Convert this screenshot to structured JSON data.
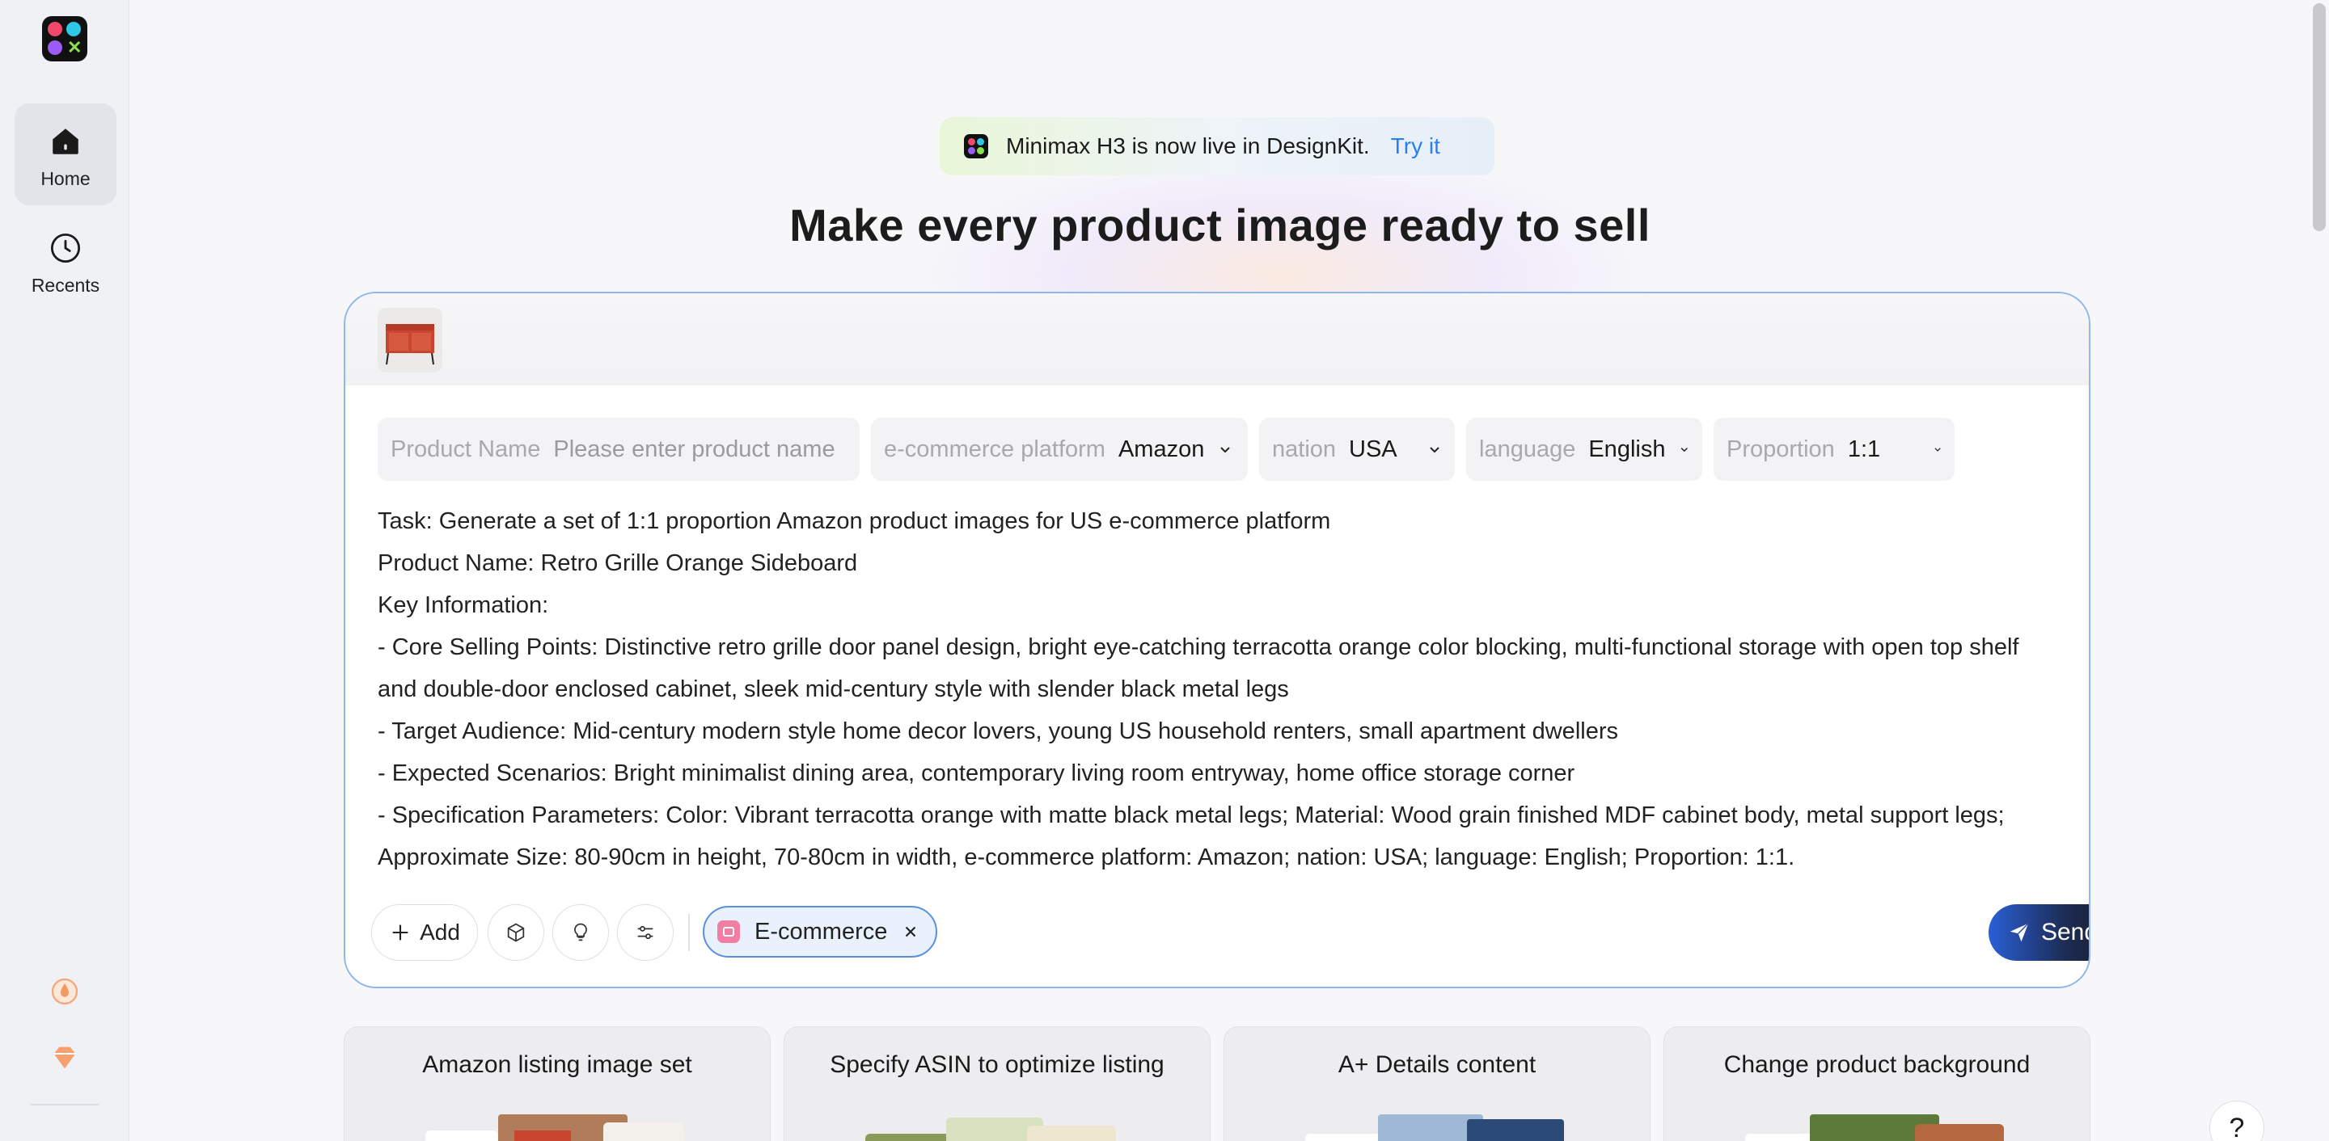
{
  "sidebar": {
    "items": [
      {
        "label": "Home",
        "icon": "home-icon",
        "active": true
      },
      {
        "label": "Recents",
        "icon": "clock-icon",
        "active": false
      }
    ],
    "extra_icons": [
      "coin-icon",
      "diamond-icon"
    ]
  },
  "banner": {
    "text": "Minimax H3 is now live in DesignKit.",
    "link": "Try it"
  },
  "hero": {
    "title": "Make every product image ready to sell"
  },
  "composer": {
    "fields": {
      "product_name": {
        "key": "Product Name",
        "placeholder": "Please enter product name"
      },
      "platform": {
        "key": "e-commerce platform",
        "value": "Amazon"
      },
      "nation": {
        "key": "nation",
        "value": "USA"
      },
      "language": {
        "key": "language",
        "value": "English"
      },
      "proportion": {
        "key": "Proportion",
        "value": "1:1"
      }
    },
    "lines": [
      "Task: Generate a set of 1:1 proportion Amazon product images for US e-commerce platform",
      "Product Name: Retro Grille Orange Sideboard",
      "Key Information:",
      "- Core Selling Points: Distinctive retro grille door panel design, bright eye-catching terracotta orange color blocking, multi-functional storage with open top shelf",
      "and double-door enclosed cabinet, sleek mid-century style with slender black metal legs",
      "- Target Audience: Mid-century modern style home decor lovers, young US household renters, small apartment dwellers",
      "- Expected Scenarios: Bright minimalist dining area, contemporary living room entryway, home office storage corner",
      "- Specification Parameters: Color: Vibrant terracotta orange with matte black metal legs; Material: Wood grain finished MDF cabinet body, metal support legs;",
      "Approximate Size: 80-90cm in height, 70-80cm in width, e-commerce platform: Amazon; nation: USA; language: English; Proportion: 1:1."
    ],
    "add_label": "Add",
    "tag_label": "E-commerce",
    "send_label": "Send"
  },
  "cards": [
    {
      "title": "Amazon listing image set"
    },
    {
      "title": "Specify ASIN to optimize listing"
    },
    {
      "title": "A+ Details content"
    },
    {
      "title": "Change product background"
    }
  ],
  "help_label": "?",
  "colors": {
    "accent": "#2a7ff0",
    "border": "#8fb7ef",
    "tag_border": "#5a8fe0"
  }
}
